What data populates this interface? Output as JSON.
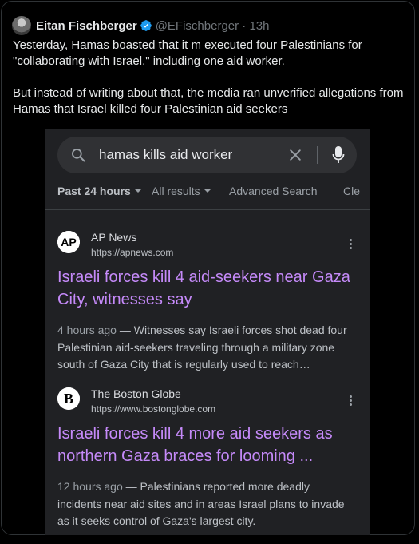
{
  "tweet": {
    "author_name": "Eitan Fischberger",
    "handle_time": "@EFischberger · 13h",
    "paragraphs": [
      "Yesterday, Hamas boasted that it m executed four Palestinians for \"collaborating with Israel,\" including one aid worker.",
      "But instead of writing about that, the media ran unverified allegations from Hamas that Israel killed four Palestinian aid seekers"
    ]
  },
  "search": {
    "query": "hamas kills aid worker",
    "filters": [
      "Past 24 hours",
      "All results",
      "Advanced Search",
      "Cle"
    ]
  },
  "results": [
    {
      "source": "AP News",
      "url": "https://apnews.com",
      "favicon": "AP",
      "title": "Israeli forces kill 4 aid-seekers near Gaza City, witnesses say",
      "age": "4 hours ago",
      "snippet": "— Witnesses say Israeli forces shot dead four Palestinian aid-seekers traveling through a military zone south of Gaza City that is regularly used to reach…"
    },
    {
      "source": "The Boston Globe",
      "url": "https://www.bostonglobe.com",
      "favicon": "B",
      "title": "Israeli forces kill 4 more aid seekers as northern Gaza braces for looming ...",
      "age": "12 hours ago",
      "snippet": "— Palestinians reported more deadly incidents near aid sites and in areas Israel plans to invade as it seeks control of Gaza's largest city."
    }
  ],
  "colors": {
    "link_title": "#c58af9",
    "verified": "#1d9bf0",
    "search_bg": "#303134",
    "panel_bg": "#202124"
  }
}
